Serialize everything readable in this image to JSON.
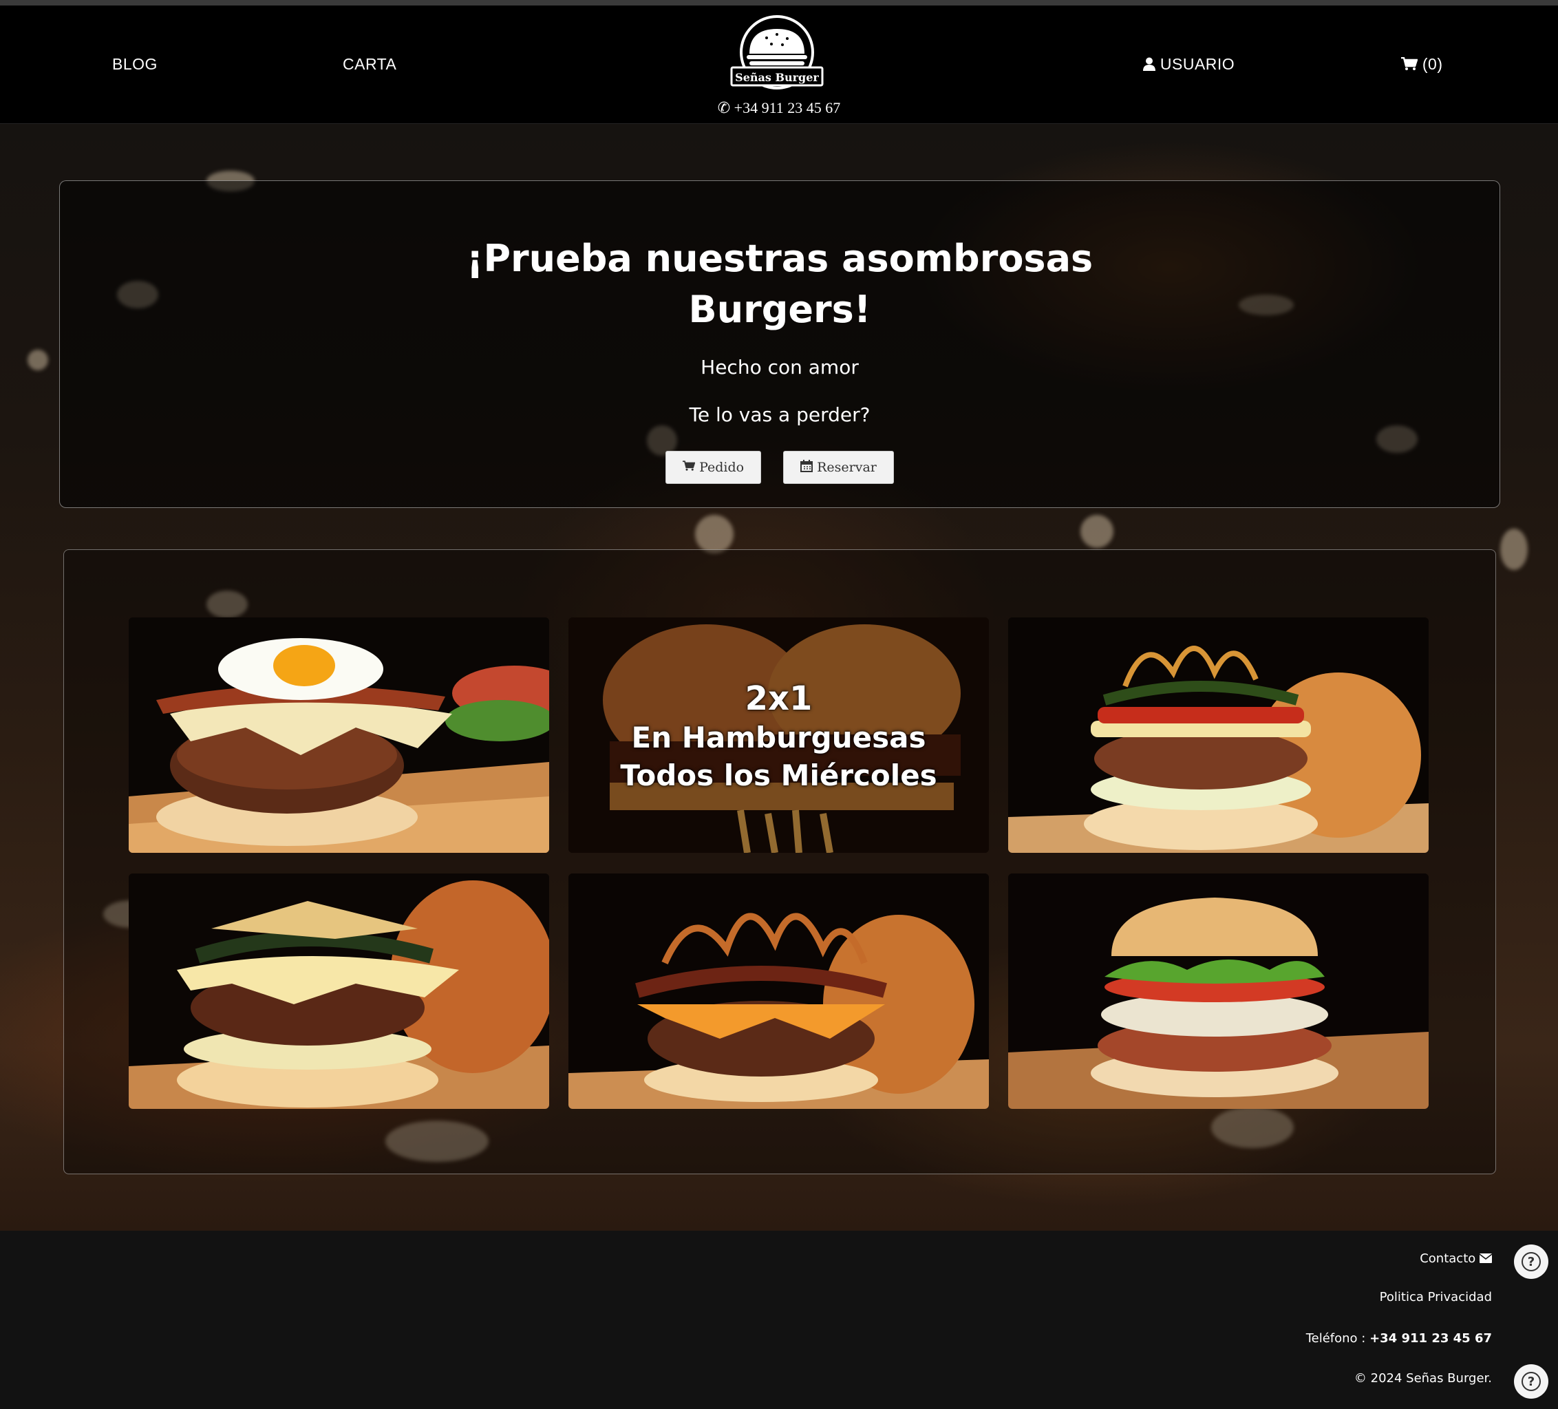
{
  "nav": {
    "blog": "BLOG",
    "carta": "CARTA",
    "usuario": "USUARIO",
    "cart_count": "(0)",
    "phone": "+34 911 23 45 67"
  },
  "logo": {
    "text": "Señas Burger"
  },
  "hero": {
    "title_line1": "¡Prueba nuestras asombrosas",
    "title_line2": "Burgers!",
    "subtitle1": "Hecho con amor",
    "subtitle2": "Te lo vas a perder?",
    "btn_pedido": "Pedido",
    "btn_reservar": "Reservar"
  },
  "promo": {
    "line1": "2x1",
    "line2": "En Hamburguesas",
    "line3": "Todos los Miércoles"
  },
  "footer": {
    "contacto": "Contacto",
    "privacidad": "Politica Privacidad",
    "telefono_label": "Teléfono :",
    "telefono_value": "+34 911 23 45 67",
    "copyright": "© 2024 Señas Burger."
  },
  "icons": {
    "phone": "phone-icon",
    "user": "user-icon",
    "cart": "cart-icon",
    "calendar": "calendar-icon",
    "envelope": "envelope-icon",
    "help": "question-icon"
  }
}
